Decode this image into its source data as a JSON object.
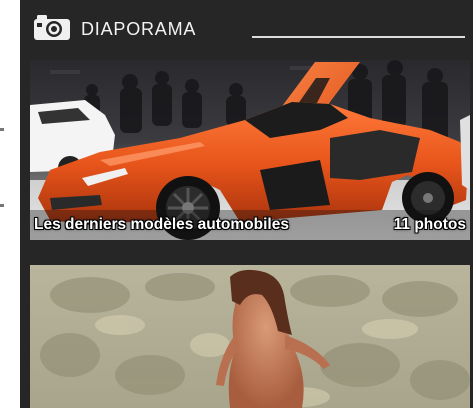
{
  "widget": {
    "title": "DIAPORAMA",
    "icon": "camera-icon"
  },
  "galleries": [
    {
      "title": "Les derniers modèles automobiles",
      "count": "11 photos",
      "thumbnail": "orange-sports-car-photo"
    },
    {
      "thumbnail": "woman-by-water-photo"
    }
  ],
  "colors": {
    "panel_background": "#262626",
    "header_text": "#f2f2f2",
    "car_orange": "#e8551b"
  }
}
